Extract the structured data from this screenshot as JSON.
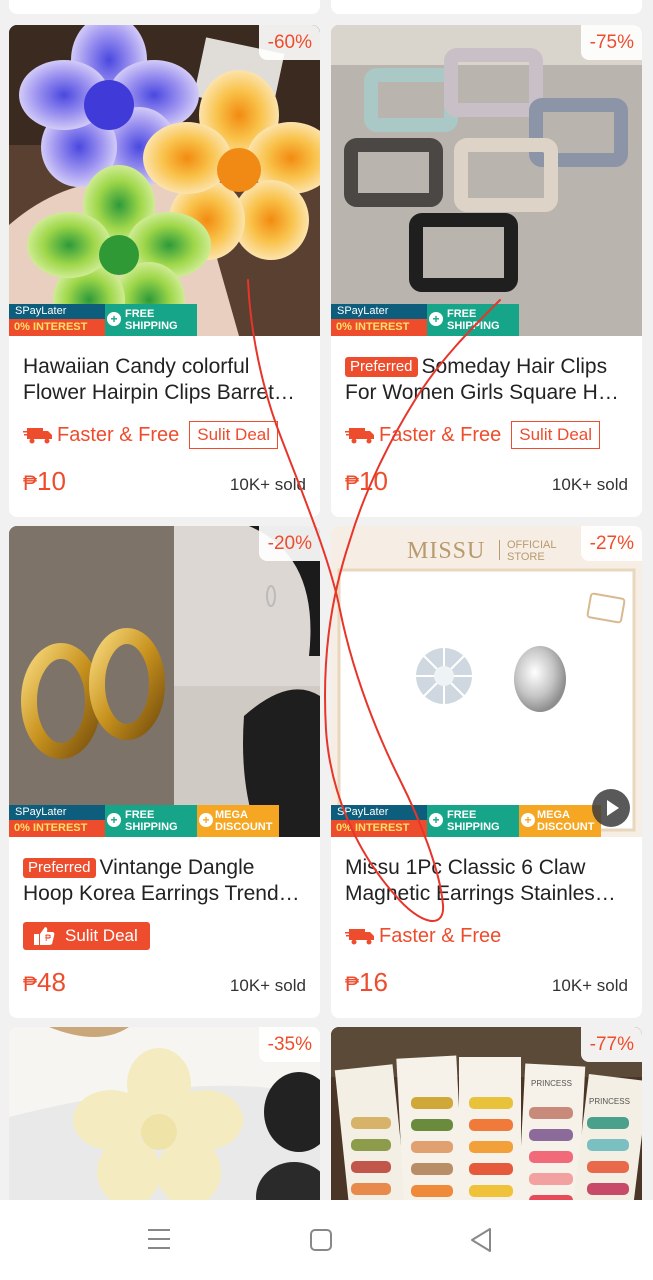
{
  "products": [
    {
      "discount": "-60%",
      "preferred": "",
      "title": "Hawaiian Candy colorful Flower Hairpin Clips Barret…",
      "faster": "Faster & Free",
      "sulit": "Sulit Deal",
      "currency": "₱",
      "price": "10",
      "sold": "10K+ sold",
      "badges": {
        "spaylater": "SPayLater",
        "interest": "0% INTEREST",
        "free1": "FREE",
        "free2": "SHIPPING",
        "mega1": "",
        "mega2": ""
      }
    },
    {
      "discount": "-75%",
      "preferred": "Preferred",
      "title": "Someday Hair Clips For Women Girls Square H…",
      "faster": "Faster & Free",
      "sulit": "Sulit Deal",
      "currency": "₱",
      "price": "10",
      "sold": "10K+ sold",
      "badges": {
        "spaylater": "SPayLater",
        "interest": "0% INTEREST",
        "free1": "FREE",
        "free2": "SHIPPING",
        "mega1": "",
        "mega2": ""
      }
    },
    {
      "discount": "-20%",
      "preferred": "Preferred",
      "title": "Vintange Dangle Hoop Korea Earrings Trend…",
      "faster": "",
      "sulit": "Sulit Deal",
      "currency": "₱",
      "price": "48",
      "sold": "10K+ sold",
      "badges": {
        "spaylater": "SPayLater",
        "interest": "0% INTEREST",
        "free1": "FREE",
        "free2": "SHIPPING",
        "mega1": "MEGA",
        "mega2": "DISCOUNT"
      }
    },
    {
      "discount": "-27%",
      "preferred": "",
      "title": "Missu 1Pc Classic 6 Claw Magnetic Earrings Stainles…",
      "faster": "Faster & Free",
      "sulit": "",
      "currency": "₱",
      "price": "16",
      "sold": "10K+ sold",
      "store_logo": "MISSU",
      "store_tag1": "OFFICIAL",
      "store_tag2": "STORE",
      "badges": {
        "spaylater": "SPayLater",
        "interest": "0% INTEREST",
        "free1": "FREE",
        "free2": "SHIPPING",
        "mega1": "MEGA",
        "mega2": "DISCOUNT"
      }
    },
    {
      "discount": "-35%"
    },
    {
      "discount": "-77%",
      "pack1": "PRINCESS",
      "pack2": "PRINCESS"
    }
  ]
}
